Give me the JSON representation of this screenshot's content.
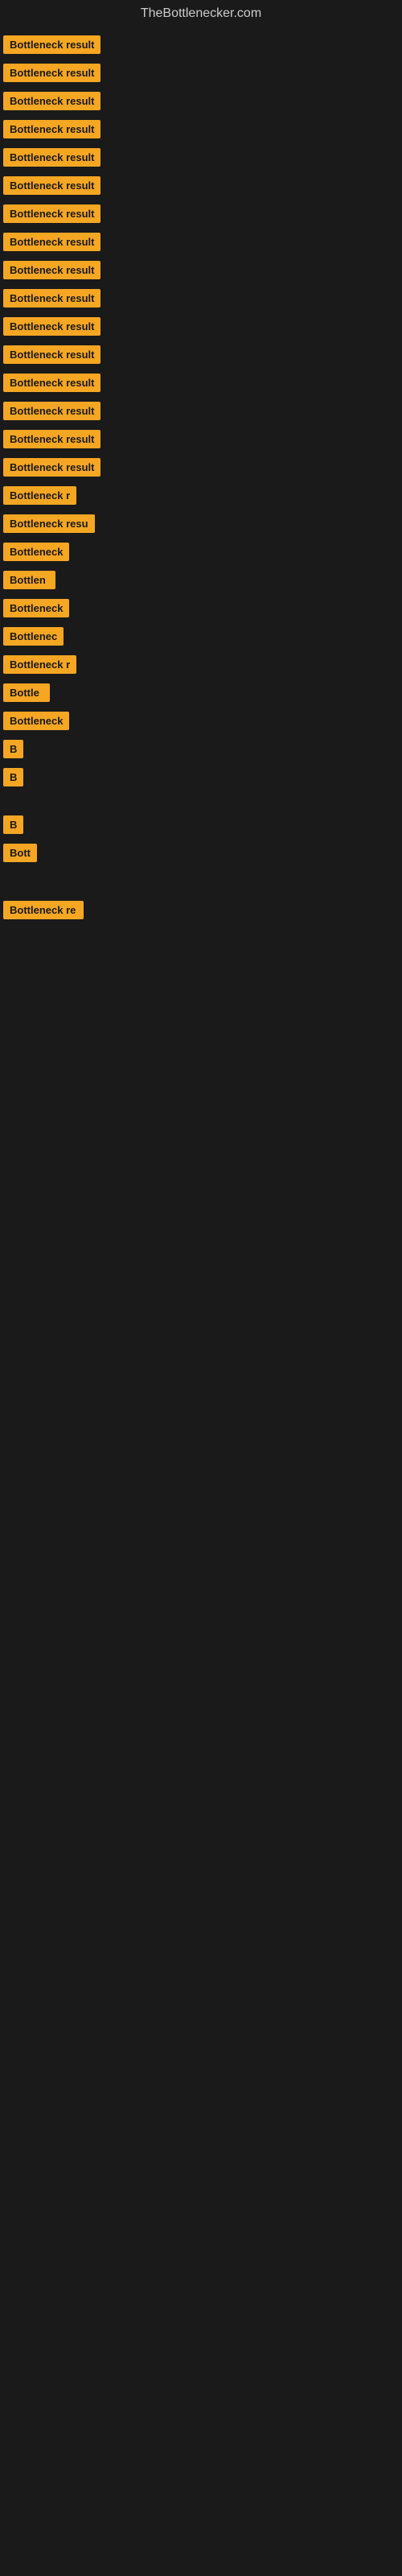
{
  "site": {
    "title": "TheBottlenecker.com"
  },
  "rows": [
    {
      "label": "Bottleneck result",
      "bar_width": 0,
      "badge_width": 120
    },
    {
      "label": "Bottleneck result",
      "bar_width": 0,
      "badge_width": 120
    },
    {
      "label": "Bottleneck result",
      "bar_width": 0,
      "badge_width": 120
    },
    {
      "label": "Bottleneck result",
      "bar_width": 0,
      "badge_width": 120
    },
    {
      "label": "Bottleneck result",
      "bar_width": 0,
      "badge_width": 120
    },
    {
      "label": "Bottleneck result",
      "bar_width": 0,
      "badge_width": 120
    },
    {
      "label": "Bottleneck result",
      "bar_width": 0,
      "badge_width": 120
    },
    {
      "label": "Bottleneck result",
      "bar_width": 0,
      "badge_width": 120
    },
    {
      "label": "Bottleneck result",
      "bar_width": 0,
      "badge_width": 120
    },
    {
      "label": "Bottleneck result",
      "bar_width": 0,
      "badge_width": 120
    },
    {
      "label": "Bottleneck result",
      "bar_width": 0,
      "badge_width": 120
    },
    {
      "label": "Bottleneck result",
      "bar_width": 0,
      "badge_width": 120
    },
    {
      "label": "Bottleneck result",
      "bar_width": 0,
      "badge_width": 120
    },
    {
      "label": "Bottleneck result",
      "bar_width": 0,
      "badge_width": 120
    },
    {
      "label": "Bottleneck result",
      "bar_width": 0,
      "badge_width": 120
    },
    {
      "label": "Bottleneck result",
      "bar_width": 0,
      "badge_width": 120
    },
    {
      "label": "Bottleneck r",
      "bar_width": 0,
      "badge_width": 90
    },
    {
      "label": "Bottleneck resu",
      "bar_width": 0,
      "badge_width": 105
    },
    {
      "label": "Bottleneck",
      "bar_width": 0,
      "badge_width": 80
    },
    {
      "label": "Bottlen",
      "bar_width": 0,
      "badge_width": 65
    },
    {
      "label": "Bottleneck",
      "bar_width": 0,
      "badge_width": 80
    },
    {
      "label": "Bottlenec",
      "bar_width": 0,
      "badge_width": 75
    },
    {
      "label": "Bottleneck r",
      "bar_width": 0,
      "badge_width": 90
    },
    {
      "label": "Bottle",
      "bar_width": 0,
      "badge_width": 58
    },
    {
      "label": "Bottleneck",
      "bar_width": 0,
      "badge_width": 80
    },
    {
      "label": "B",
      "bar_width": 0,
      "badge_width": 22
    },
    {
      "label": "B",
      "bar_width": 0,
      "badge_width": 10
    },
    {
      "label": "",
      "bar_width": 0,
      "badge_width": 0
    },
    {
      "label": "",
      "bar_width": 0,
      "badge_width": 0
    },
    {
      "label": "B",
      "bar_width": 0,
      "badge_width": 12
    },
    {
      "label": "Bott",
      "bar_width": 0,
      "badge_width": 40
    },
    {
      "label": "",
      "bar_width": 0,
      "badge_width": 0
    },
    {
      "label": "",
      "bar_width": 0,
      "badge_width": 0
    },
    {
      "label": "",
      "bar_width": 0,
      "badge_width": 0
    },
    {
      "label": "Bottleneck re",
      "bar_width": 0,
      "badge_width": 100
    }
  ]
}
